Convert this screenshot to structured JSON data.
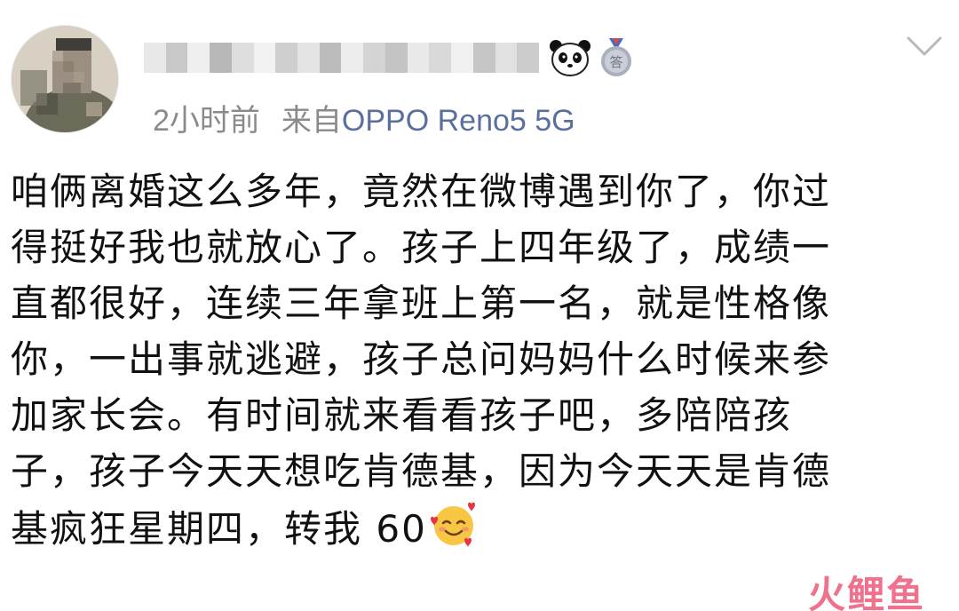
{
  "post": {
    "username": "·····················",
    "meta": {
      "time": "2小时前",
      "source_prefix": "来自",
      "device": "OPPO Reno5 5G"
    },
    "icons": {
      "panda_badge": "panda-icon",
      "medal_badge": "medal-icon",
      "more_menu": "chevron-down-icon",
      "emoji": "smiling-face-with-hearts-icon"
    },
    "content_lines": [
      "咱俩离婚这么多年，竟然在微博遇到你了，你过",
      "得挺好我也就放心了。孩子上四年级了，成绩一",
      "直都很好，连续三年拿班上第一名，就是性格像",
      "你，一出事就逃避，孩子总问妈妈什么时候来参",
      "加家长会。有时间就来看看孩子吧，多陪陪孩",
      "子，孩子今天天想吃肯德基，因为今天天是肯德",
      "基疯狂星期四，转我 60"
    ]
  },
  "watermark": {
    "text": "火鲤鱼"
  },
  "colors": {
    "meta_gray": "#8a8a8a",
    "device_blue": "#5b6f9f",
    "text": "#111111",
    "watermark": "#f06a86"
  }
}
